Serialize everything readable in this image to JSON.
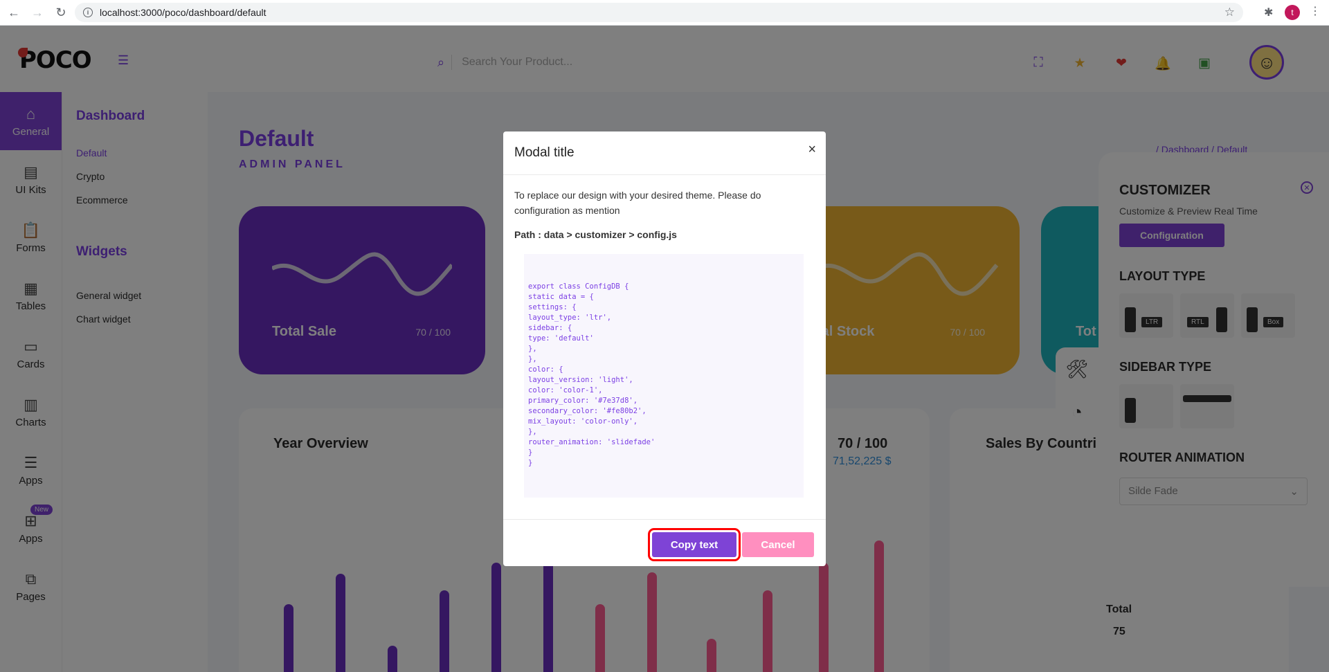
{
  "browser": {
    "url": "localhost:3000/poco/dashboard/default",
    "profile_initial": "t"
  },
  "header": {
    "logo": "POCO",
    "search_placeholder": "Search Your Product..."
  },
  "iconbar": {
    "items": [
      {
        "label": "General",
        "icon": "home-icon"
      },
      {
        "label": "UI Kits",
        "icon": "briefcase-icon"
      },
      {
        "label": "Forms",
        "icon": "clipboard-icon"
      },
      {
        "label": "Tables",
        "icon": "table-icon"
      },
      {
        "label": "Cards",
        "icon": "card-icon"
      },
      {
        "label": "Charts",
        "icon": "chart-icon"
      },
      {
        "label": "Apps",
        "icon": "database-icon"
      },
      {
        "label": "Apps",
        "icon": "gift-icon",
        "badge": "New"
      },
      {
        "label": "Pages",
        "icon": "pages-icon"
      }
    ]
  },
  "subbar": {
    "dashboard_heading": "Dashboard",
    "dashboard_items": [
      "Default",
      "Crypto",
      "Ecommerce"
    ],
    "widgets_heading": "Widgets",
    "widgets_items": [
      "General widget",
      "Chart widget"
    ]
  },
  "main": {
    "title": "Default",
    "subtitle": "ADMIN PANEL",
    "breadcrumb": "/ Dashboard / Default",
    "cards": [
      {
        "label": "Total Sale",
        "value": "70 / 100",
        "color": "#6a2fc2"
      },
      {
        "label": "tal Stock",
        "value": "70 / 100",
        "color": "#f0b532"
      },
      {
        "label": "Tot",
        "value": "",
        "color": "#1fb5bf"
      }
    ],
    "year_overview": "Year Overview",
    "mid_value": "70 / 100",
    "mid_amount": "71,52,225 $",
    "sales_title": "Sales By Countri",
    "total_label": "Total",
    "total_value": "75"
  },
  "customizer": {
    "title": "CUSTOMIZER",
    "subtitle": "Customize & Preview Real Time",
    "config_button": "Configuration",
    "layout_type": "LAYOUT TYPE",
    "layout_options": [
      "LTR",
      "RTL",
      "Box"
    ],
    "sidebar_type": "SIDEBAR TYPE",
    "router_animation": "ROUTER ANIMATION",
    "router_value": "Silde Fade"
  },
  "modal": {
    "title": "Modal title",
    "close": "×",
    "description": "To replace our design with your desired theme. Please do configuration as mention",
    "path": "Path : data > customizer > config.js",
    "code": "export class ConfigDB {\nstatic data = {\nsettings: {\nlayout_type: 'ltr',\nsidebar: {\ntype: 'default'\n},\n},\ncolor: {\nlayout_version: 'light',\ncolor: 'color-1',\nprimary_color: '#7e37d8',\nsecondary_color: '#fe80b2',\nmix_layout: 'color-only',\n},\nrouter_animation: 'slidefade'\n}\n}",
    "copy_button": "Copy text",
    "cancel_button": "Cancel"
  }
}
